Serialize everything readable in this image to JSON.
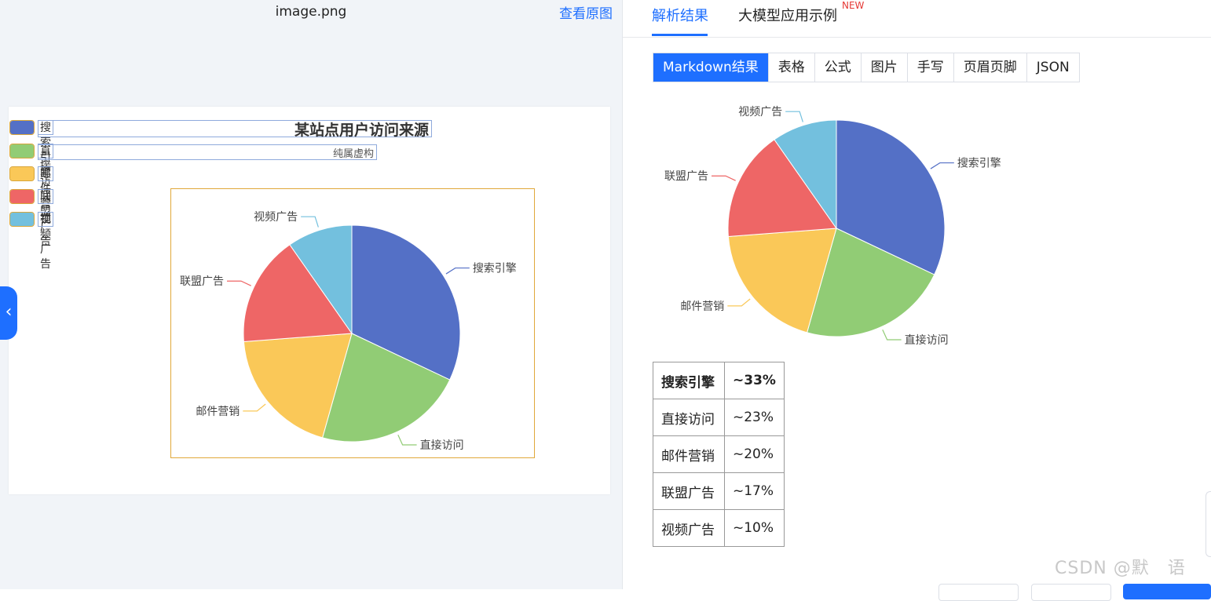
{
  "left": {
    "file_name": "image.png",
    "view_original": "查看原图",
    "collapse_icon": "chevron-left-icon",
    "legend": [
      {
        "label": "搜索引擎",
        "color": "#5470c6"
      },
      {
        "label": "直接访问",
        "color": "#91cc75"
      },
      {
        "label": "邮件营销",
        "color": "#fac858"
      },
      {
        "label": "联盟广告",
        "color": "#ee6666"
      },
      {
        "label": "视频广告",
        "color": "#73c0de"
      }
    ]
  },
  "right": {
    "tabs": {
      "parse": "解析结果",
      "llm": "大模型应用示例",
      "new_badge": "NEW"
    },
    "seg_tabs": [
      "Markdown结果",
      "表格",
      "公式",
      "图片",
      "手写",
      "页眉页脚",
      "JSON"
    ],
    "table": [
      {
        "name": "搜索引擎",
        "value": "~33%"
      },
      {
        "name": "直接访问",
        "value": "~23%"
      },
      {
        "name": "邮件营销",
        "value": "~20%"
      },
      {
        "name": "联盟广告",
        "value": "~17%"
      },
      {
        "name": "视频广告",
        "value": "~10%"
      }
    ],
    "watermark": "CSDN @默　语"
  },
  "chart_data": [
    {
      "type": "pie",
      "title": "某站点用户访问来源",
      "subtitle": "纯属虚构",
      "categories": [
        "搜索引擎",
        "直接访问",
        "邮件营销",
        "联盟广告",
        "视频广告"
      ],
      "values": [
        33,
        23,
        20,
        17,
        10
      ],
      "colors": [
        "#5470c6",
        "#91cc75",
        "#fac858",
        "#ee6666",
        "#73c0de"
      ],
      "legend": "top-left"
    },
    {
      "type": "pie",
      "categories": [
        "搜索引擎",
        "直接访问",
        "邮件营销",
        "联盟广告",
        "视频广告"
      ],
      "values": [
        33,
        23,
        20,
        17,
        10
      ],
      "colors": [
        "#5470c6",
        "#91cc75",
        "#fac858",
        "#ee6666",
        "#73c0de"
      ]
    }
  ]
}
